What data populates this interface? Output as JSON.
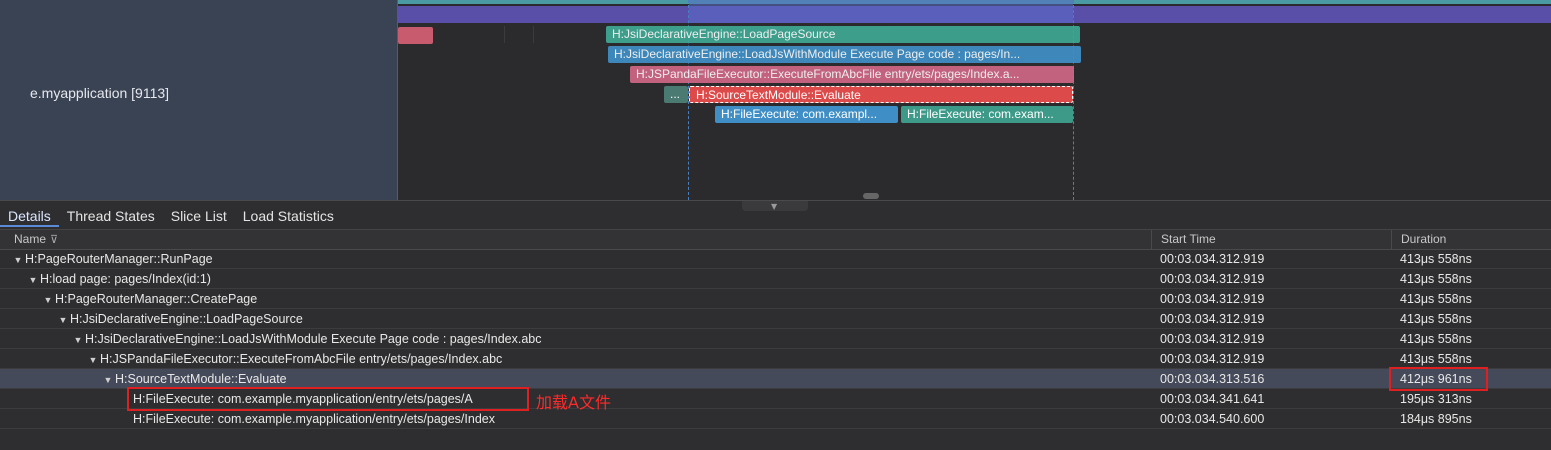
{
  "thread": {
    "label": "e.myapplication [9113]"
  },
  "slices": {
    "load_page_source": "H:JsiDeclarativeEngine::LoadPageSource",
    "load_js_with_module": "H:JsiDeclarativeEngine::LoadJsWithModule Execute Page code : pages/In...",
    "execute_from_abc": "H:JSPandaFileExecutor::ExecuteFromAbcFile entry/ets/pages/Index.a...",
    "evaluate": "H:SourceTextModule::Evaluate",
    "ellipsis": "...",
    "file_exec_a": "H:FileExecute: com.exampl...",
    "file_exec_b": "H:FileExecute: com.exam..."
  },
  "tabs": [
    "Details",
    "Thread States",
    "Slice List",
    "Load Statistics"
  ],
  "table": {
    "headers": {
      "name": "Name",
      "start": "Start Time",
      "duration": "Duration"
    },
    "rows": [
      {
        "name": "H:PageRouterManager::RunPage",
        "start": "00:03.034.312.919",
        "duration": "413μs 558ns"
      },
      {
        "name": "H:load page: pages/Index(id:1)",
        "start": "00:03.034.312.919",
        "duration": "413μs 558ns"
      },
      {
        "name": "H:PageRouterManager::CreatePage",
        "start": "00:03.034.312.919",
        "duration": "413μs 558ns"
      },
      {
        "name": "H:JsiDeclarativeEngine::LoadPageSource",
        "start": "00:03.034.312.919",
        "duration": "413μs 558ns"
      },
      {
        "name": "H:JsiDeclarativeEngine::LoadJsWithModule Execute Page code : pages/Index.abc",
        "start": "00:03.034.312.919",
        "duration": "413μs 558ns"
      },
      {
        "name": "H:JSPandaFileExecutor::ExecuteFromAbcFile entry/ets/pages/Index.abc",
        "start": "00:03.034.312.919",
        "duration": "413μs 558ns"
      },
      {
        "name": "H:SourceTextModule::Evaluate",
        "start": "00:03.034.313.516",
        "duration": "412μs 961ns"
      },
      {
        "name": "H:FileExecute: com.example.myapplication/entry/ets/pages/A",
        "start": "00:03.034.341.641",
        "duration": "195μs 313ns"
      },
      {
        "name": "H:FileExecute: com.example.myapplication/entry/ets/pages/Index",
        "start": "00:03.034.540.600",
        "duration": "184μs 895ns"
      }
    ]
  },
  "annotation": {
    "text": "加载A文件",
    "color": "#ff2a2a"
  },
  "colors": {
    "selection": "#454a5a",
    "highlight": "#e02020",
    "tab_accent": "#5a8ad8"
  }
}
